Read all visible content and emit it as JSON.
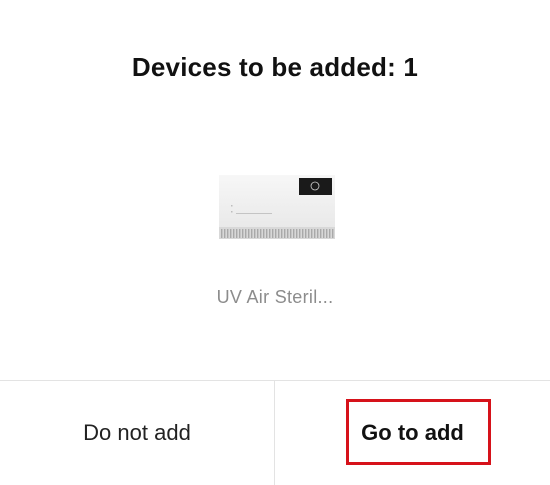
{
  "dialog": {
    "title": "Devices to be added: 1"
  },
  "device": {
    "name": "UV Air Steril...",
    "image_icon": "air-sterilizer-device-icon"
  },
  "buttons": {
    "cancel_label": "Do not add",
    "confirm_label": "Go to add"
  },
  "colors": {
    "title_text": "#111111",
    "device_name_text": "#8c8c8c",
    "divider": "#e3e3e3",
    "highlight_outline": "#d6121a"
  }
}
